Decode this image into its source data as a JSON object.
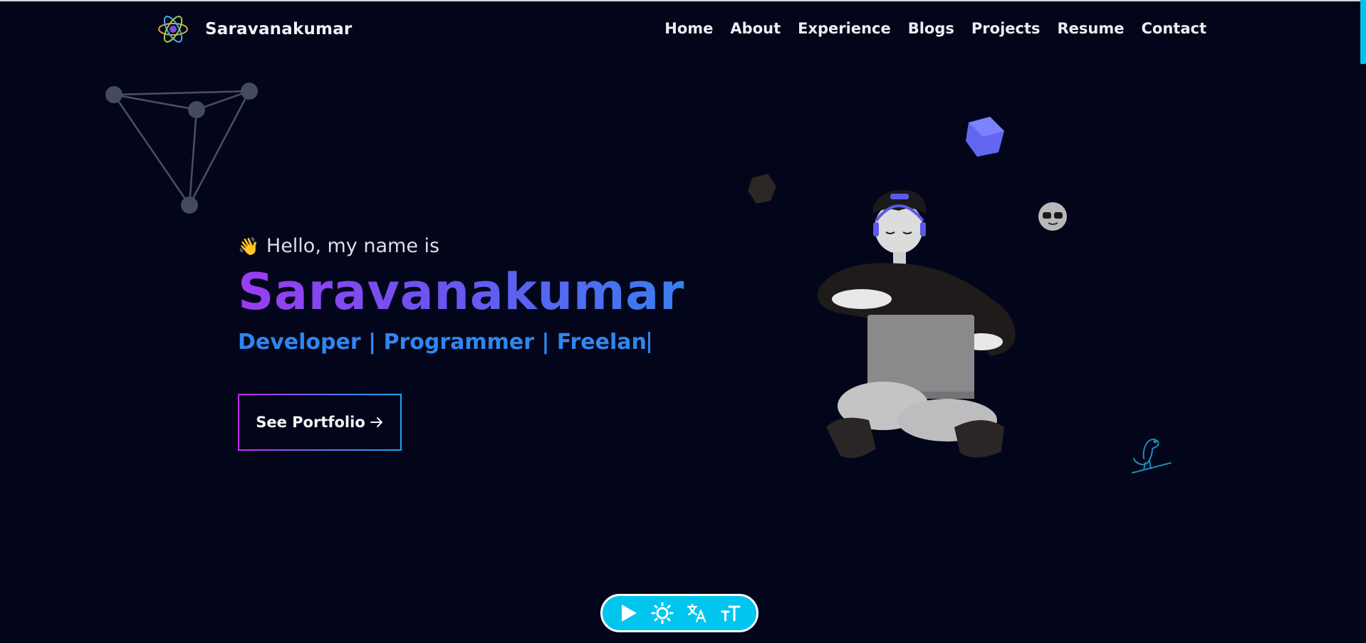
{
  "brand": {
    "name": "Saravanakumar",
    "logo_icon": "atom-icon"
  },
  "nav": {
    "items": [
      {
        "label": "Home"
      },
      {
        "label": "About"
      },
      {
        "label": "Experience"
      },
      {
        "label": "Blogs"
      },
      {
        "label": "Projects"
      },
      {
        "label": "Resume"
      },
      {
        "label": "Contact"
      }
    ]
  },
  "hero": {
    "greeting": "Hello, my name is",
    "greeting_icon": "waving-hand-icon",
    "name": "Saravanakumar",
    "roles_typed": "Developer | Programmer | Freelan",
    "cta_label": "See Portfolio",
    "cta_icon": "arrow-right-icon"
  },
  "toolbar": {
    "buttons": [
      {
        "icon": "play-icon"
      },
      {
        "icon": "sun-icon"
      },
      {
        "icon": "translate-icon"
      },
      {
        "icon": "text-size-icon"
      }
    ]
  },
  "colors": {
    "background": "#03061a",
    "accent_cyan": "#00c6ef",
    "gradient_start": "#9b3cf0",
    "gradient_end": "#3a7ef0",
    "role_text": "#2f86f0"
  }
}
